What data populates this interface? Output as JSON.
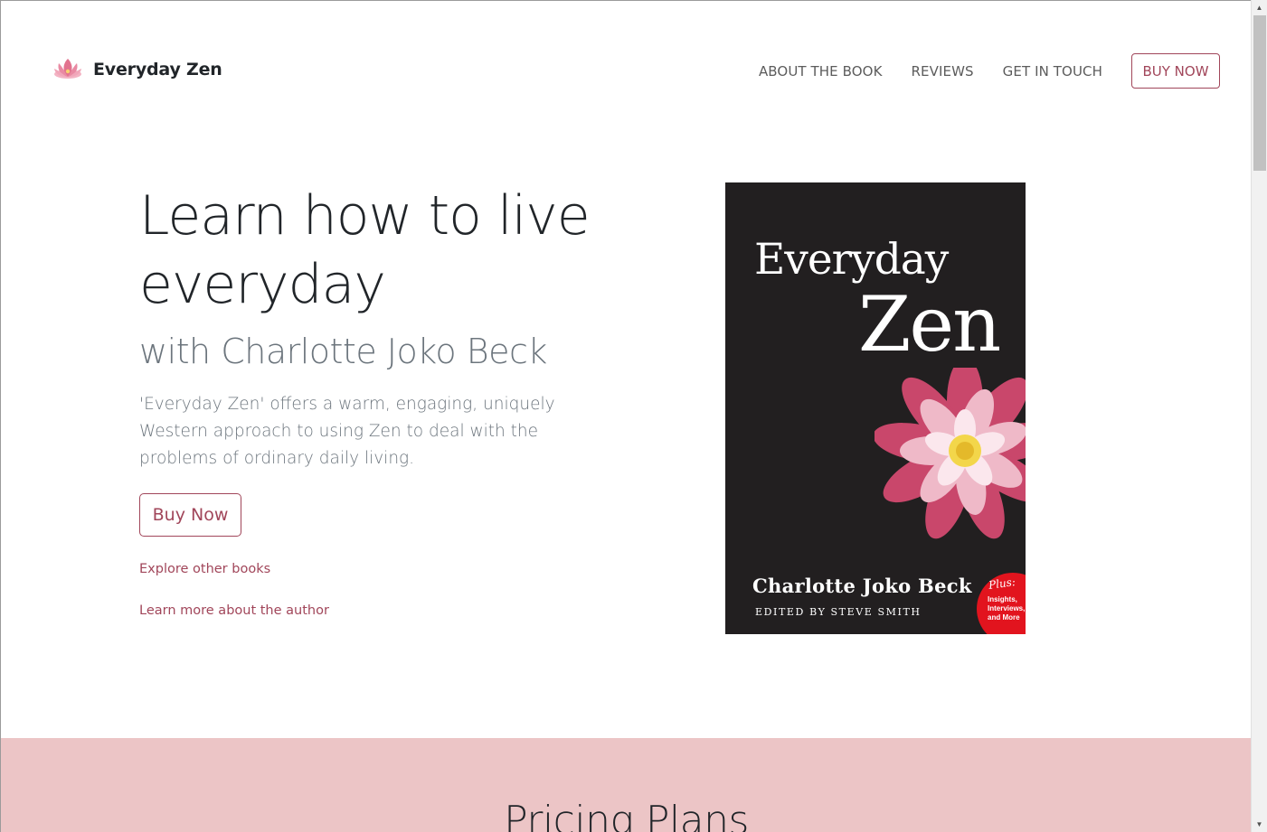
{
  "navbar": {
    "brand_title": "Everyday Zen",
    "brand_icon": "lotus-icon",
    "links": [
      "ABOUT THE BOOK",
      "REVIEWS",
      "GET IN TOUCH"
    ],
    "buy_label": "BUY NOW"
  },
  "hero": {
    "title_line1": "Learn how to live",
    "title_line2": "everyday",
    "subtitle": "with Charlotte Joko Beck",
    "description": "'Everyday Zen' offers a warm, engaging, uniquely Western approach to using Zen to deal with the problems of ordinary daily living.",
    "buy_label": "Buy Now",
    "link_explore": "Explore other books",
    "link_author": "Learn more about the author"
  },
  "cover": {
    "title_line1": "Everyday",
    "title_line2": "Zen",
    "author": "Charlotte Joko Beck",
    "editor": "EDITED BY STEVE SMITH",
    "badge_plus": "Plus:",
    "badge_text": "Insights, Interviews, and More"
  },
  "pricing": {
    "title": "Pricing Plans"
  },
  "colors": {
    "accent": "#a1465a",
    "pricing_bg": "#ecc5c6",
    "cover_bg": "#221f20",
    "badge_red": "#e2141e"
  }
}
